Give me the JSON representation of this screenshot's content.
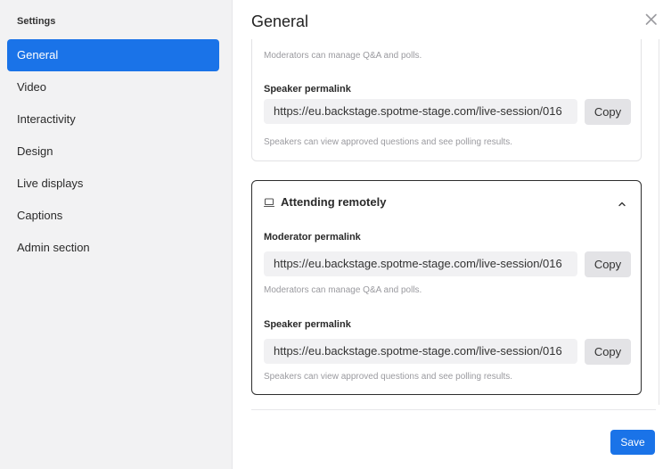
{
  "sidebar": {
    "title": "Settings",
    "items": [
      {
        "label": "General",
        "active": true
      },
      {
        "label": "Video",
        "active": false
      },
      {
        "label": "Interactivity",
        "active": false
      },
      {
        "label": "Design",
        "active": false
      },
      {
        "label": "Live displays",
        "active": false
      },
      {
        "label": "Captions",
        "active": false
      },
      {
        "label": "Admin section",
        "active": false
      }
    ]
  },
  "header": {
    "title": "General",
    "close_icon": "close-icon"
  },
  "card_onsite": {
    "moderator_hint": "Moderators can manage Q&A and polls.",
    "speaker_label": "Speaker permalink",
    "speaker_url": "https://eu.backstage.spotme-stage.com/live-session/016",
    "speaker_copy": "Copy",
    "speaker_hint": "Speakers can view approved questions and see polling results."
  },
  "card_remote": {
    "title": "Attending remotely",
    "icon": "laptop-icon",
    "chevron_icon": "chevron-up-icon",
    "moderator_label": "Moderator permalink",
    "moderator_url": "https://eu.backstage.spotme-stage.com/live-session/016",
    "moderator_copy": "Copy",
    "moderator_hint": "Moderators can manage Q&A and polls.",
    "speaker_label": "Speaker permalink",
    "speaker_url": "https://eu.backstage.spotme-stage.com/live-session/016",
    "speaker_copy": "Copy",
    "speaker_hint": "Speakers can view approved questions and see polling results."
  },
  "footer": {
    "save_label": "Save"
  },
  "colors": {
    "accent": "#1a73e8",
    "sidebar_bg": "#f2f2f3",
    "field_bg": "#f1f1f3",
    "button_bg": "#e3e3e6"
  }
}
